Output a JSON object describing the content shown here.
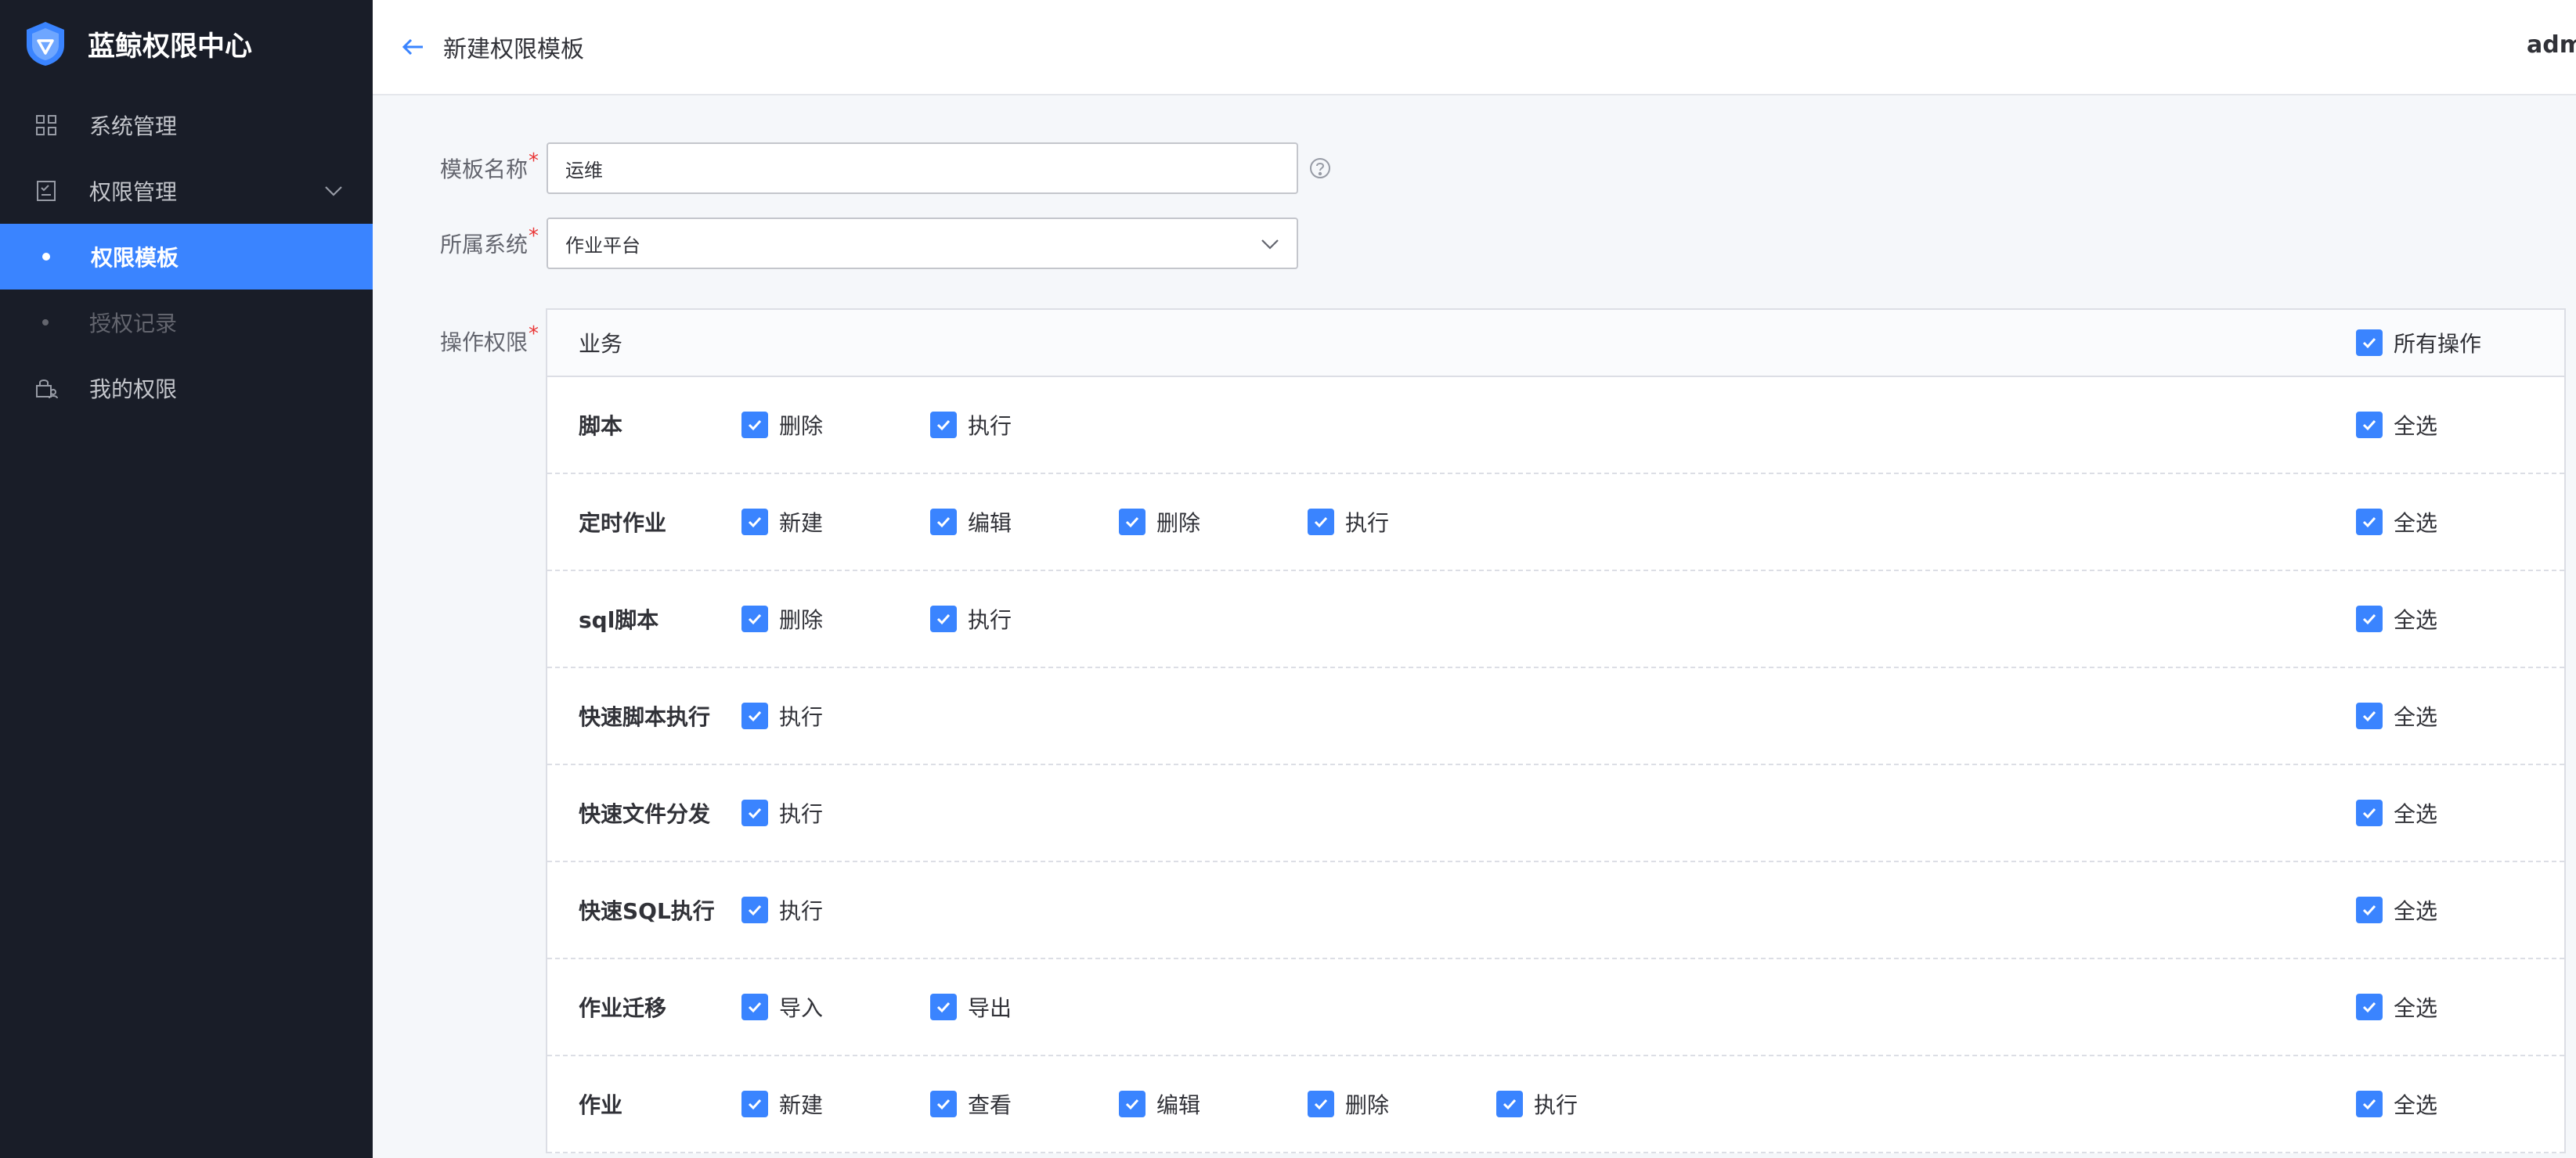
{
  "app": {
    "title": "蓝鲸权限中心"
  },
  "sidebar": {
    "items": [
      {
        "label": "系统管理",
        "icon": "grid-icon"
      },
      {
        "label": "权限管理",
        "icon": "checklist-icon",
        "expanded": true,
        "children": [
          {
            "label": "权限模板",
            "active": true
          },
          {
            "label": "授权记录",
            "active": false
          }
        ]
      },
      {
        "label": "我的权限",
        "icon": "lock-user-icon"
      }
    ]
  },
  "header": {
    "title": "新建权限模板",
    "user": "adm"
  },
  "form": {
    "name_label": "模板名称",
    "name_value": "运维",
    "system_label": "所属系统",
    "system_value": "作业平台",
    "perm_label": "操作权限",
    "required_mark": "*"
  },
  "perm_table": {
    "header_label": "业务",
    "all_ops_label": "所有操作",
    "select_all_label": "全选",
    "rows": [
      {
        "name": "脚本",
        "ops": [
          "删除",
          "执行"
        ]
      },
      {
        "name": "定时作业",
        "ops": [
          "新建",
          "编辑",
          "删除",
          "执行"
        ]
      },
      {
        "name": "sql脚本",
        "ops": [
          "删除",
          "执行"
        ]
      },
      {
        "name": "快速脚本执行",
        "ops": [
          "执行"
        ]
      },
      {
        "name": "快速文件分发",
        "ops": [
          "执行"
        ]
      },
      {
        "name": "快速SQL执行",
        "ops": [
          "执行"
        ]
      },
      {
        "name": "作业迁移",
        "ops": [
          "导入",
          "导出"
        ]
      },
      {
        "name": "作业",
        "ops": [
          "新建",
          "查看",
          "编辑",
          "删除",
          "执行"
        ]
      }
    ]
  },
  "colors": {
    "sidebar_bg": "#191d28",
    "accent": "#3a84ff",
    "required": "#ea3636"
  }
}
